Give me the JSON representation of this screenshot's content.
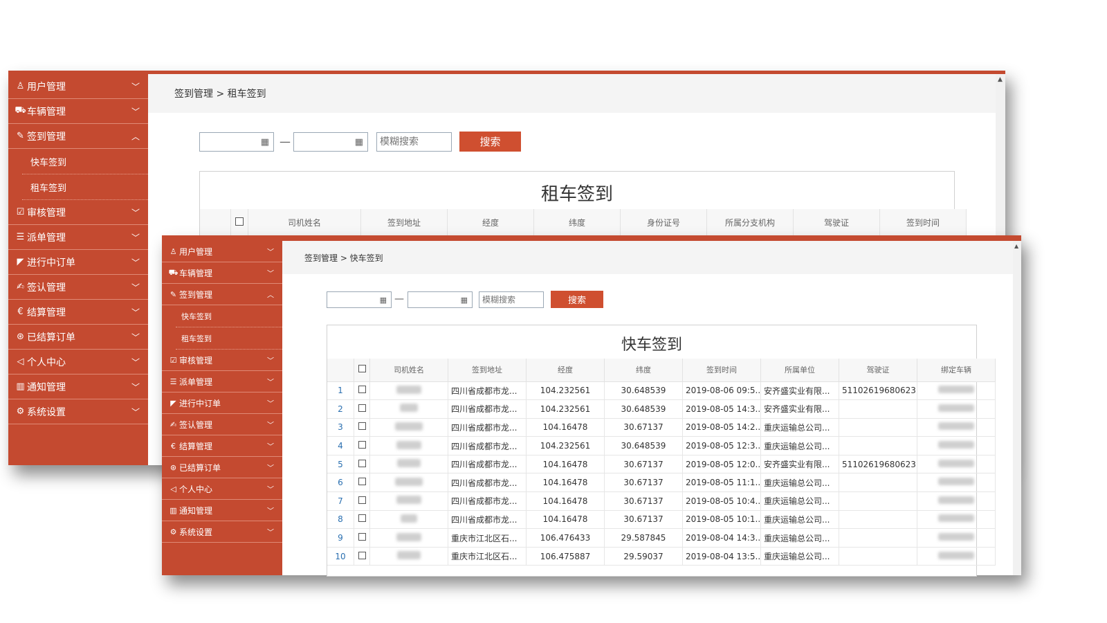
{
  "back": {
    "breadcrumb": "签到管理 > 租车签到",
    "search_placeholder": "模糊搜索",
    "search_button": "搜索",
    "panel_title": "租车签到",
    "columns": [
      "司机姓名",
      "签到地址",
      "经度",
      "纬度",
      "身份证号",
      "所属分支机构",
      "驾驶证",
      "签到时间"
    ]
  },
  "front": {
    "breadcrumb": "签到管理 > 快车签到",
    "search_placeholder": "模糊搜索",
    "search_button": "搜索",
    "panel_title": "快车签到",
    "columns": [
      "司机姓名",
      "签到地址",
      "经度",
      "纬度",
      "签到时间",
      "所属单位",
      "驾驶证",
      "绑定车辆"
    ],
    "rows": [
      {
        "num": "1",
        "address": "四川省成都市龙...",
        "lng": "104.232561",
        "lat": "30.648539",
        "time": "2019-08-06 09:5...",
        "unit": "安齐盛实业有限...",
        "license": "51102619680623..."
      },
      {
        "num": "2",
        "address": "四川省成都市龙...",
        "lng": "104.232561",
        "lat": "30.648539",
        "time": "2019-08-05 14:3...",
        "unit": "安齐盛实业有限...",
        "license": ""
      },
      {
        "num": "3",
        "address": "四川省成都市龙...",
        "lng": "104.16478",
        "lat": "30.67137",
        "time": "2019-08-05 14:2...",
        "unit": "重庆运输总公司...",
        "license": ""
      },
      {
        "num": "4",
        "address": "四川省成都市龙...",
        "lng": "104.232561",
        "lat": "30.648539",
        "time": "2019-08-05 12:3...",
        "unit": "重庆运输总公司...",
        "license": ""
      },
      {
        "num": "5",
        "address": "四川省成都市龙...",
        "lng": "104.16478",
        "lat": "30.67137",
        "time": "2019-08-05 12:0...",
        "unit": "安齐盛实业有限...",
        "license": "51102619680623..."
      },
      {
        "num": "6",
        "address": "四川省成都市龙...",
        "lng": "104.16478",
        "lat": "30.67137",
        "time": "2019-08-05 11:1...",
        "unit": "重庆运输总公司...",
        "license": ""
      },
      {
        "num": "7",
        "address": "四川省成都市龙...",
        "lng": "104.16478",
        "lat": "30.67137",
        "time": "2019-08-05 10:4...",
        "unit": "重庆运输总公司...",
        "license": ""
      },
      {
        "num": "8",
        "address": "四川省成都市龙...",
        "lng": "104.16478",
        "lat": "30.67137",
        "time": "2019-08-05 10:1...",
        "unit": "重庆运输总公司...",
        "license": ""
      },
      {
        "num": "9",
        "address": "重庆市江北区石...",
        "lng": "106.476433",
        "lat": "29.587845",
        "time": "2019-08-04 14:3...",
        "unit": "重庆运输总公司...",
        "license": ""
      },
      {
        "num": "10",
        "address": "重庆市江北区石...",
        "lng": "106.475887",
        "lat": "29.59037",
        "time": "2019-08-04 13:5...",
        "unit": "重庆运输总公司...",
        "license": ""
      }
    ]
  },
  "menu": [
    {
      "label": "用户管理",
      "icon": "user-icon",
      "expanded": false
    },
    {
      "label": "车辆管理",
      "icon": "car-icon",
      "expanded": false
    },
    {
      "label": "签到管理",
      "icon": "signin-icon",
      "expanded": true,
      "children": [
        "快车签到",
        "租车签到"
      ]
    },
    {
      "label": "审核管理",
      "icon": "checklist-icon",
      "expanded": false
    },
    {
      "label": "派单管理",
      "icon": "dispatch-icon",
      "expanded": false
    },
    {
      "label": "进行中订单",
      "icon": "flag-icon",
      "expanded": false
    },
    {
      "label": "签认管理",
      "icon": "edit-icon",
      "expanded": false
    },
    {
      "label": "结算管理",
      "icon": "currency-icon",
      "expanded": false
    },
    {
      "label": "已结算订单",
      "icon": "settled-icon",
      "expanded": false
    },
    {
      "label": "个人中心",
      "icon": "speaker-icon",
      "expanded": false
    },
    {
      "label": "通知管理",
      "icon": "bar-chart-icon",
      "expanded": false
    },
    {
      "label": "系统设置",
      "icon": "gear-icon",
      "expanded": false
    }
  ],
  "colors": {
    "brand": "#c44a30",
    "button": "#cf4f30",
    "link_number": "#2a6fb0"
  }
}
